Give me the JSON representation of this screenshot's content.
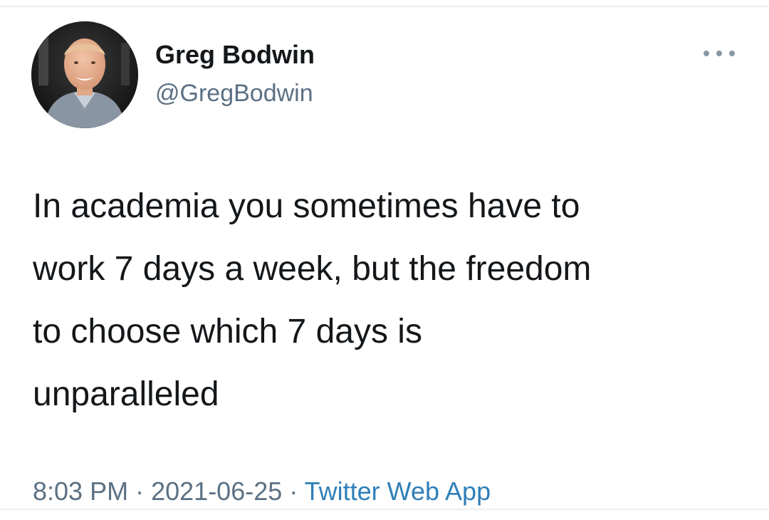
{
  "author": {
    "display_name": "Greg Bodwin",
    "handle": "@GregBodwin",
    "avatar_icon": "profile-photo"
  },
  "tweet": {
    "lines": [
      "In academia you sometimes have to",
      "work 7 days a week, but the freedom",
      "to choose which 7 days is",
      "unparalleled"
    ]
  },
  "meta": {
    "time": "8:03 PM",
    "separator": "·",
    "date": "2021-06-25",
    "source": "Twitter Web App"
  },
  "menu": {
    "icon": "more-options-icon"
  },
  "colors": {
    "text": "#14171a",
    "secondary": "#5b7083",
    "link": "#2f7fb8",
    "divider": "#eceef0"
  }
}
